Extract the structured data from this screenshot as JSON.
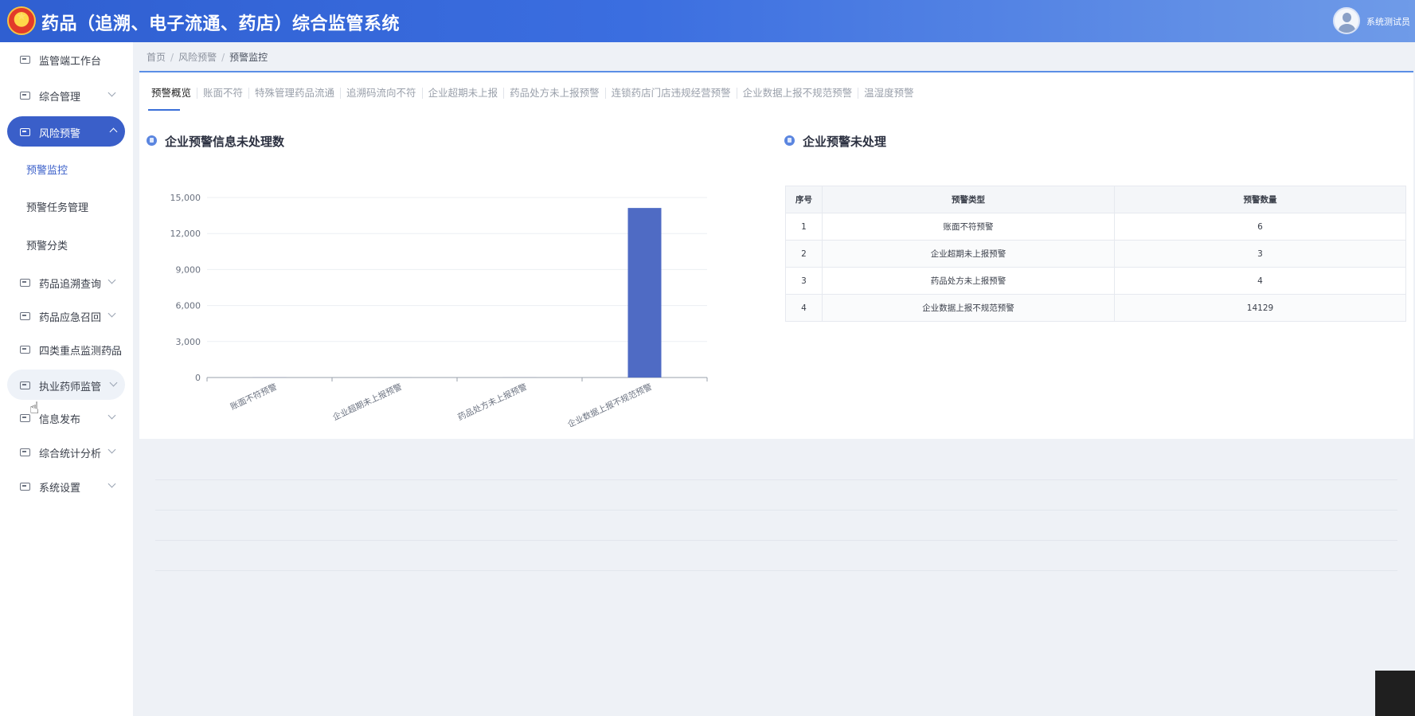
{
  "header": {
    "title": "药品（追溯、电子流通、药店）综合监管系统",
    "user": "系统测试员"
  },
  "sidebar": {
    "items": [
      {
        "label": "监管端工作台"
      },
      {
        "label": "综合管理"
      },
      {
        "label": "风险预警"
      },
      {
        "label": "药品追溯查询"
      },
      {
        "label": "药品应急召回"
      },
      {
        "label": "四类重点监测药品"
      },
      {
        "label": "执业药师监管"
      },
      {
        "label": "信息发布"
      },
      {
        "label": "综合统计分析"
      },
      {
        "label": "系统设置"
      }
    ],
    "sub_items": [
      {
        "label": "预警监控"
      },
      {
        "label": "预警任务管理"
      },
      {
        "label": "预警分类"
      }
    ]
  },
  "breadcrumb": [
    "首页",
    "风险预警",
    "预警监控"
  ],
  "tabs": [
    "预警概览",
    "账面不符",
    "特殊管理药品流通",
    "追溯码流向不符",
    "企业超期未上报",
    "药品处方未上报预警",
    "连锁药店门店违规经营预警",
    "企业数据上报不规范预警",
    "温湿度预警"
  ],
  "left_section": {
    "title": "企业预警信息未处理数"
  },
  "right_section": {
    "title": "企业预警未处理"
  },
  "table": {
    "headers": [
      "序号",
      "预警类型",
      "预警数量"
    ],
    "rows": [
      [
        "1",
        "账面不符预警",
        "6"
      ],
      [
        "2",
        "企业超期未上报预警",
        "3"
      ],
      [
        "3",
        "药品处方未上报预警",
        "4"
      ],
      [
        "4",
        "企业数据上报不规范预警",
        "14129"
      ]
    ]
  },
  "colors": {
    "accent": "#3a5fc9",
    "bar": "#4f6bc4"
  },
  "chart_data": {
    "type": "bar",
    "categories": [
      "账面不符预警",
      "企业超期未上报预警",
      "药品处方未上报预警",
      "企业数据上报不规范预警"
    ],
    "values": [
      6,
      3,
      4,
      14129
    ],
    "ylim": [
      0,
      15000
    ],
    "yticks": [
      "0",
      "3,000",
      "6,000",
      "9,000",
      "12,000",
      "15,000"
    ],
    "grid": true
  }
}
